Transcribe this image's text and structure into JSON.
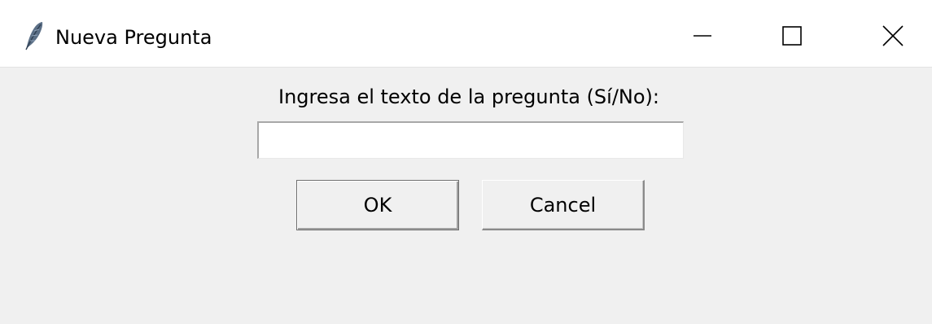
{
  "window": {
    "title": "Nueva Pregunta",
    "icon": "feather-icon"
  },
  "window_controls": {
    "minimize_icon": "minimize-icon",
    "maximize_icon": "maximize-icon",
    "close_icon": "close-icon"
  },
  "dialog": {
    "prompt": "Ingresa el texto de la pregunta (Sí/No):",
    "input_value": "",
    "ok_label": "OK",
    "cancel_label": "Cancel"
  }
}
